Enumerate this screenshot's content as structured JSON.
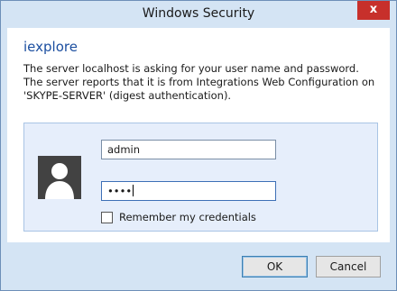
{
  "window": {
    "title": "Windows Security",
    "close_label": "x"
  },
  "dialog": {
    "app_name": "iexplore",
    "message": "The server localhost is asking for your user name and password. The server reports that it is from Integrations Web Configuration on 'SKYPE-SERVER' (digest authentication).",
    "username_value": "admin",
    "password_masked": "••••",
    "remember_label": "Remember my credentials",
    "remember_checked": false
  },
  "buttons": {
    "ok": "OK",
    "cancel": "Cancel"
  },
  "icons": {
    "avatar": "user-silhouette-icon",
    "close": "close-icon"
  },
  "colors": {
    "accent": "#1c4fa0",
    "close": "#c7302b",
    "frame": "#d4e4f4"
  }
}
